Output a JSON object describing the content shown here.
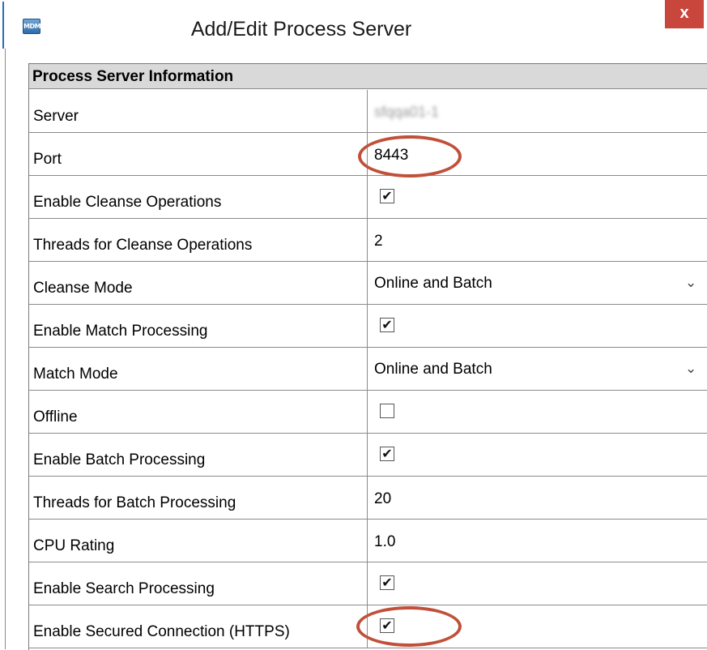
{
  "window": {
    "title": "Add/Edit Process Server",
    "icon_text": "MDM",
    "close_glyph": "x"
  },
  "panel": {
    "section_title": "Process Server Information",
    "fields": [
      {
        "label": "Server",
        "type": "text",
        "value": "sfqqa01-1"
      },
      {
        "label": "Port",
        "type": "text",
        "value": "8443"
      },
      {
        "label": "Enable Cleanse Operations",
        "type": "checkbox",
        "checked": true
      },
      {
        "label": "Threads for Cleanse Operations",
        "type": "text",
        "value": "2"
      },
      {
        "label": "Cleanse Mode",
        "type": "select",
        "value": "Online and Batch"
      },
      {
        "label": "Enable Match Processing",
        "type": "checkbox",
        "checked": true
      },
      {
        "label": "Match Mode",
        "type": "select",
        "value": "Online and Batch"
      },
      {
        "label": "Offline",
        "type": "checkbox",
        "checked": false
      },
      {
        "label": "Enable Batch Processing",
        "type": "checkbox",
        "checked": true
      },
      {
        "label": "Threads for Batch Processing",
        "type": "text",
        "value": "20"
      },
      {
        "label": "CPU Rating",
        "type": "text",
        "value": "1.0"
      },
      {
        "label": "Enable Search Processing",
        "type": "checkbox",
        "checked": true
      },
      {
        "label": "Enable Secured Connection (HTTPS)",
        "type": "checkbox",
        "checked": true
      }
    ]
  },
  "colors": {
    "close_button": "#c9463d",
    "annotation_circle": "#c0503a",
    "header_background": "#d9d9d9"
  },
  "icons": {
    "check": "✔",
    "chevron": "⌄"
  }
}
